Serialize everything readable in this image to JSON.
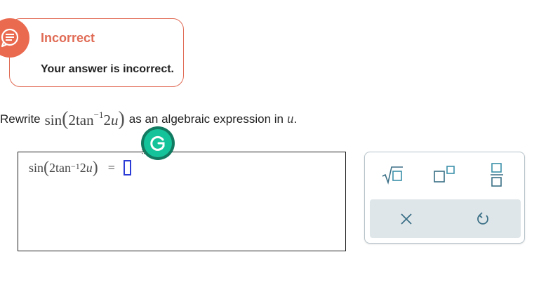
{
  "feedback": {
    "title": "Incorrect",
    "message": "Your answer is incorrect.",
    "icon": "chat-bubble-icon",
    "color": "#e06b55"
  },
  "question": {
    "prefix": "Rewrite",
    "expr": {
      "func": "sin",
      "coef": "2",
      "inverse_func": "tan",
      "exponent": "−1",
      "arg_coef": "2",
      "variable": "u"
    },
    "suffix": "as an algebraic expression in",
    "variable": "u",
    "end": "."
  },
  "answer": {
    "lhs": {
      "func": "sin",
      "coef": "2",
      "inverse_func": "tan",
      "exponent": "−1",
      "arg_coef": "2",
      "variable": "u"
    },
    "equals": "=",
    "value": ""
  },
  "toolbox": {
    "tools": [
      {
        "name": "square-root-icon"
      },
      {
        "name": "superscript-icon"
      },
      {
        "name": "fraction-icon"
      },
      {
        "name": "clear-icon"
      },
      {
        "name": "undo-icon"
      }
    ],
    "accent": "#3a8fa8"
  },
  "grammarly": {
    "icon": "grammarly-icon",
    "color": "#15c39a"
  }
}
